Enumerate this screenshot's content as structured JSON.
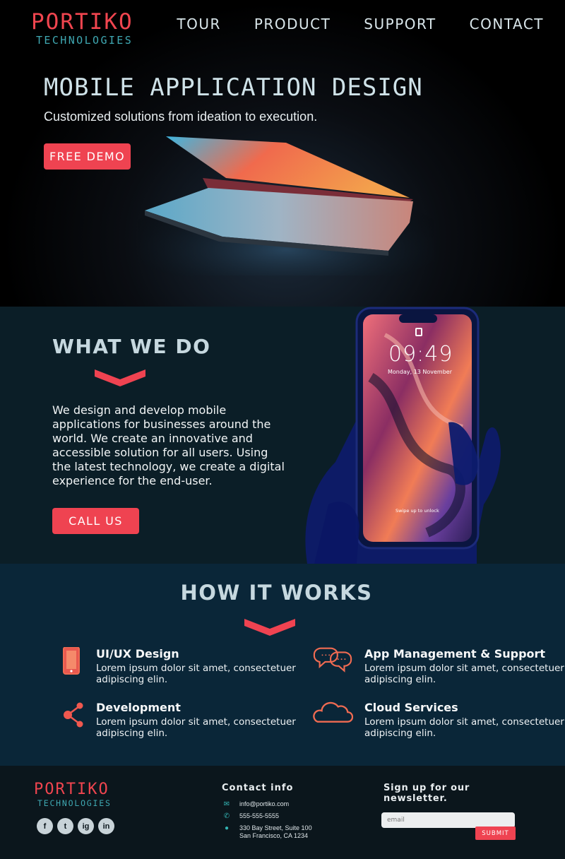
{
  "brand": {
    "name": "PORTIKO",
    "sub": "TECHNOLOGIES",
    "accent": "#ef4351",
    "teal": "#3fa8b2"
  },
  "nav": [
    {
      "label": "TOUR"
    },
    {
      "label": "PRODUCT"
    },
    {
      "label": "SUPPORT"
    },
    {
      "label": "CONTACT"
    }
  ],
  "hero": {
    "title": "MOBILE APPLICATION DESIGN",
    "tagline": "Customized solutions from ideation to execution.",
    "cta": "FREE DEMO"
  },
  "what": {
    "title": "WHAT WE DO",
    "body": "We design and develop mobile applications for businesses around the world. We create an innovative and accessible solution for all users. Using the latest technology, we create a digital experience for the end-user.",
    "cta": "CALL US",
    "phone_time": "09:49",
    "phone_date": "Monday, 13 November",
    "phone_unlock": "Swipe up to unlock"
  },
  "how": {
    "title": "HOW IT WORKS",
    "features": [
      {
        "icon": "phone-icon",
        "title": "UI/UX Design",
        "desc": "Lorem ipsum dolor sit amet, consectetuer adipiscing elin."
      },
      {
        "icon": "share-icon",
        "title": "Development",
        "desc": "Lorem ipsum dolor sit amet, consectetuer adipiscing elin."
      },
      {
        "icon": "chat-icon",
        "title": "App Management & Support",
        "desc": "Lorem ipsum dolor sit amet, consectetuer adipiscing elin."
      },
      {
        "icon": "cloud-icon",
        "title": "Cloud Services",
        "desc": "Lorem ipsum dolor sit amet, consectetuer adipiscing elin."
      }
    ]
  },
  "footer": {
    "social": [
      "f",
      "t",
      "ig",
      "in"
    ],
    "contact_title": "Contact info",
    "email": "info@portiko.com",
    "phone": "555-555-5555",
    "address1": "330 Bay Street, Suite 100",
    "address2": "San Francisco, CA 1234",
    "newsletter_title": "Sign up for our newsletter.",
    "email_placeholder": "email",
    "submit": "SUBMIT"
  }
}
